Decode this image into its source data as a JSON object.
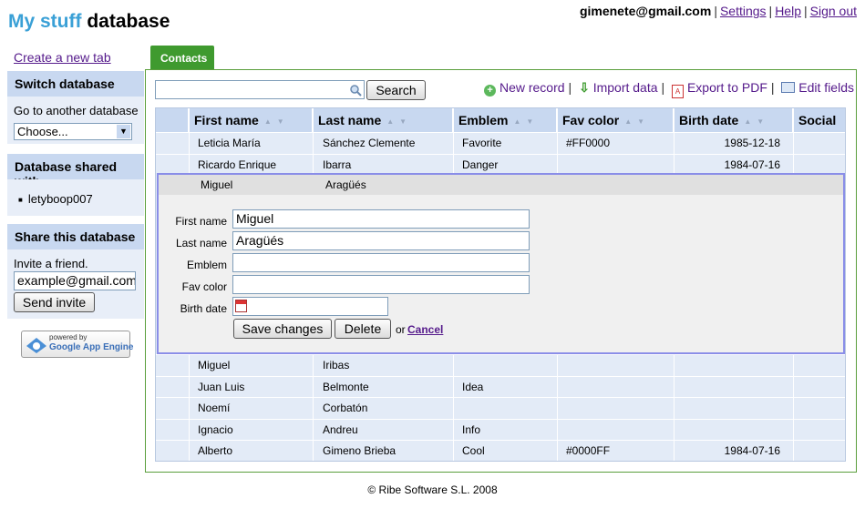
{
  "app": {
    "title_blue": "My stuff",
    "title_rest": " database"
  },
  "topnav": {
    "email": "gimenete@gmail.com",
    "settings": "Settings",
    "help": "Help",
    "signout": "Sign out"
  },
  "sidebar": {
    "create_tab": "Create a new tab",
    "switch_head": "Switch database",
    "goto_label": "Go to another database",
    "choose_value": "Choose...",
    "shared_head": "Database shared with",
    "shared_user": "letyboop007",
    "share_head": "Share this database",
    "invite_label": "Invite a friend.",
    "invite_value": "example@gmail.com",
    "send_invite": "Send invite",
    "badge_line1": "powered by",
    "badge_line2": "Google App Engine"
  },
  "tab": {
    "label": "Contacts"
  },
  "search": {
    "button": "Search",
    "value": ""
  },
  "toolbar": {
    "new_record": "New record",
    "import": "Import data",
    "export": "Export to PDF",
    "edit_fields": "Edit fields"
  },
  "columns": [
    "First name",
    "Last name",
    "Emblem",
    "Fav color",
    "Birth date",
    "Social"
  ],
  "rows_top": [
    [
      "Leticia María",
      "Sánchez Clemente",
      "Favorite",
      "#FF0000",
      "1985-12-18"
    ],
    [
      "Ricardo Enrique",
      "Ibarra",
      "Danger",
      "",
      "1984-07-16"
    ]
  ],
  "selected_row": [
    "Miguel",
    "Aragüés",
    "",
    "",
    ""
  ],
  "editor": {
    "labels": [
      "First name",
      "Last name",
      "Emblem",
      "Fav color",
      "Birth date"
    ],
    "values": [
      "Miguel",
      "Aragüés",
      "",
      "",
      ""
    ],
    "save": "Save changes",
    "delete": "Delete",
    "or": "or",
    "cancel": "Cancel"
  },
  "rows_bottom": [
    [
      "Miguel",
      "Iribas",
      "",
      "",
      ""
    ],
    [
      "Juan Luis",
      "Belmonte",
      "Idea",
      "",
      ""
    ],
    [
      "Noemí",
      "Corbatón",
      "",
      "",
      ""
    ],
    [
      "Ignacio",
      "Andreu",
      "Info",
      "",
      ""
    ],
    [
      "Alberto",
      "Gimeno Brieba",
      "Cool",
      "#0000FF",
      "1984-07-16"
    ]
  ],
  "footer": "© Ribe Software S.L. 2008",
  "colors": {
    "accent_green": "#3f9a2f",
    "header_blue": "#c8d8f0",
    "row_blue": "#e3ebf7",
    "title_blue": "#3aa0d6"
  }
}
